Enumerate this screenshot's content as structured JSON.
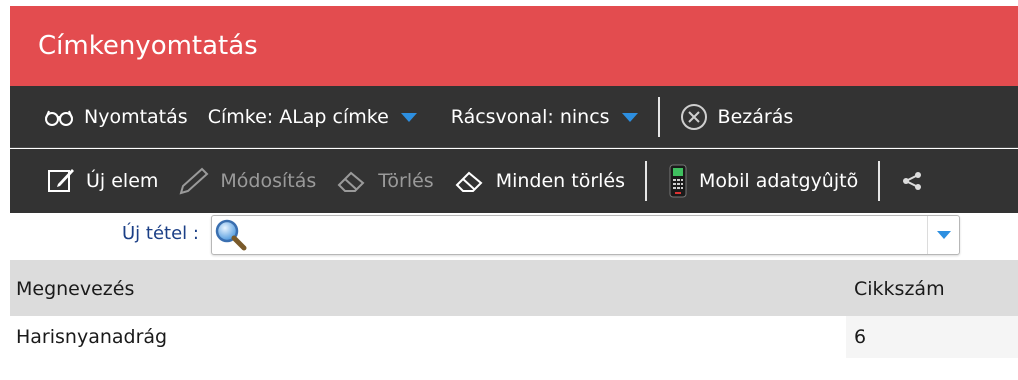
{
  "window": {
    "title": "Címkenyomtatás"
  },
  "toolbar_top": {
    "print_label": "Nyomtatás",
    "label_select": "Címke: ALap címke",
    "gridline_select": "Rácsvonal: nincs",
    "close_label": "Bezárás"
  },
  "toolbar_bottom": {
    "new_item_label": "Új elem",
    "modify_label": "Módosítás",
    "delete_label": "Törlés",
    "delete_all_label": "Minden törlés",
    "mobile_collector_label": "Mobil adatgyûjtõ"
  },
  "new_item": {
    "label": "Új tétel :",
    "value": ""
  },
  "grid": {
    "columns": [
      "Megnevezés",
      "Cikkszám"
    ],
    "rows": [
      {
        "name": "Harisnyanadrág",
        "sku": "6"
      }
    ]
  },
  "colors": {
    "title_bar": "#e34c4f",
    "toolbar": "#333333",
    "accent_caret": "#2d8fe0",
    "header_bg": "#dcdcdc"
  },
  "icons": {
    "print": "glasses-icon",
    "close": "close-circle-icon",
    "new": "edit-square-icon",
    "modify": "pencil-icon",
    "delete": "eraser-icon",
    "mobile": "handheld-scanner-icon",
    "search": "magnifier-icon",
    "more": "share-icon"
  }
}
